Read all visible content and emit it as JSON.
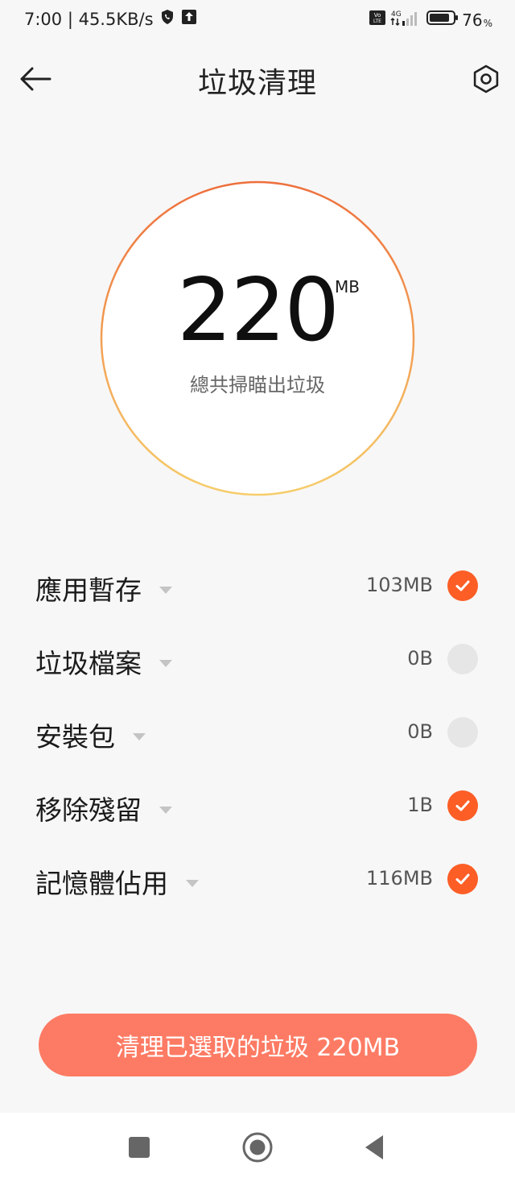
{
  "status_bar": {
    "time_speed": "7:00 | 45.5KB/s",
    "network": "4G",
    "volte": "Vo LTE",
    "battery_value": "76",
    "battery_unit": "%"
  },
  "header": {
    "title": "垃圾清理"
  },
  "summary": {
    "total_value": "220",
    "total_unit": "MB",
    "caption": "總共掃瞄出垃圾"
  },
  "categories": [
    {
      "label": "應用暫存",
      "size": "103MB",
      "checked": true
    },
    {
      "label": "垃圾檔案",
      "size": "0B",
      "checked": false
    },
    {
      "label": "安裝包",
      "size": "0B",
      "checked": false
    },
    {
      "label": "移除殘留",
      "size": "1B",
      "checked": true
    },
    {
      "label": "記憶體佔用",
      "size": "116MB",
      "checked": true
    }
  ],
  "action": {
    "clean_label": "清理已選取的垃圾 220MB"
  },
  "colors": {
    "accent": "#fc5e26",
    "button": "#fd7b64",
    "ring_top": "#ee6f3c",
    "ring_bottom": "#f6cd6a"
  }
}
